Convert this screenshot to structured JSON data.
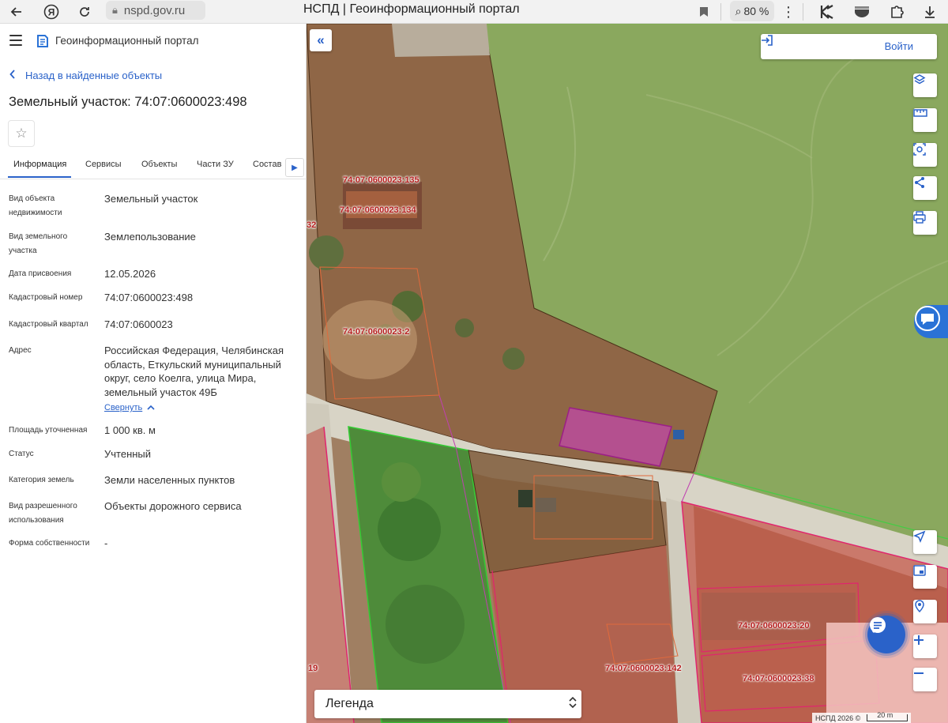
{
  "browser": {
    "url": "nspd.gov.ru",
    "tab_title": "НСПД | Геоинформационный портал",
    "zoom": "80 %"
  },
  "panel": {
    "portal_title": "Геоинформационный портал",
    "back_link": "Назад в найденные объекты",
    "object_title": "Земельный участок: 74:07:0600023:498",
    "tabs": [
      "Информация",
      "Сервисы",
      "Объекты",
      "Части ЗУ",
      "Состав"
    ],
    "active_tab": "Информация",
    "fields": [
      {
        "label": "Вид объекта недвижимости",
        "value": "Земельный участок"
      },
      {
        "label": "Вид земельного участка",
        "value": "Землепользование"
      },
      {
        "label": "Дата присвоения",
        "value": "12.05.2026"
      },
      {
        "label": "Кадастровый номер",
        "value": "74:07:0600023:498"
      },
      {
        "label": "Кадастровый квартал",
        "value": "74:07:0600023"
      },
      {
        "label": "Адрес",
        "value": "Российская Федерация, Челябинская область, Еткульский муниципальный округ, село Коелга, улица Мира, земельный участок 49Б"
      },
      {
        "label": "Площадь уточненная",
        "value": "1 000 кв. м"
      },
      {
        "label": "Статус",
        "value": "Учтенный"
      },
      {
        "label": "Категория земель",
        "value": "Земли населенных пунктов"
      },
      {
        "label": "Вид разрешенного использования",
        "value": "Объекты дорожного сервиса"
      },
      {
        "label": "Форма собственности",
        "value": "-"
      }
    ],
    "collapse_label": "Свернуть"
  },
  "map": {
    "login_label": "Войти",
    "legend_label": "Легенда",
    "attribution": "НСПД 2026 ©",
    "scale_label": "20 m",
    "parcel_labels": [
      "74:07:0600023:135",
      "74:07:0600023:134",
      "74:07:0600023:2",
      "74:07:0600023:20",
      "74:07:0600023:142",
      "74:07:0600023:38",
      "32",
      "19"
    ],
    "tools": [
      "layers-icon",
      "ruler-icon",
      "select-area-icon",
      "share-icon",
      "print-icon",
      "locate-icon",
      "minimap-icon",
      "geo-search-icon",
      "zoom-in-icon",
      "zoom-out-icon"
    ],
    "colors": {
      "accent": "#2a62c9",
      "field_green": "#8aa85e",
      "parcel_brown": "#7a4a2a",
      "selected_magenta": "#c04aa8",
      "zone_red": "#d8445a"
    }
  }
}
